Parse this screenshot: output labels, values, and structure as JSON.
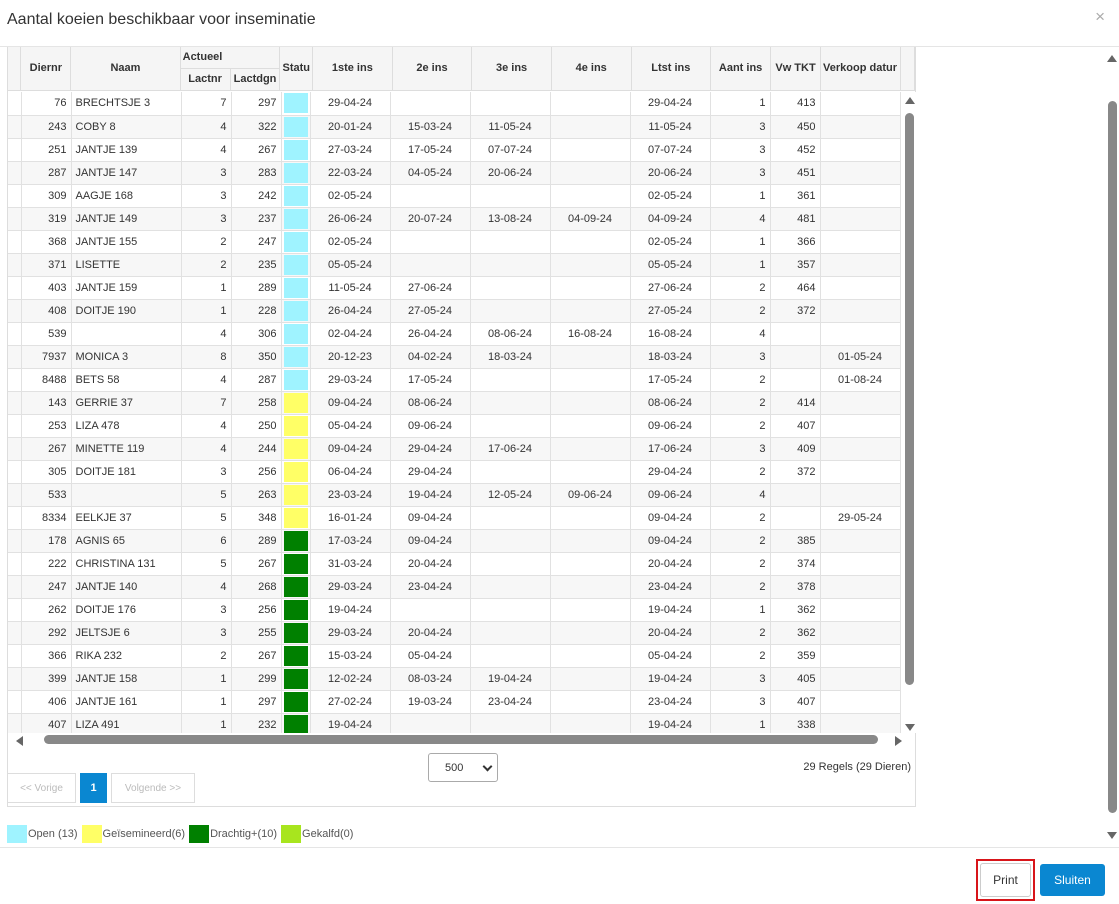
{
  "modal": {
    "title": "Aantal koeien beschikbaar voor inseminatie",
    "close_glyph": "×"
  },
  "table": {
    "group_header": "Actueel",
    "columns": {
      "diernr": "Diernr",
      "naam": "Naam",
      "lactnr": "Lactnr",
      "lactdgn": "Lactdgn",
      "status": "Statu",
      "ins1": "1ste ins",
      "ins2": "2e ins",
      "ins3": "3e ins",
      "ins4": "4e ins",
      "ltst": "Ltst ins",
      "aant": "Aant ins",
      "vwtkt": "Vw TKT",
      "verkoop": "Verkoop datur"
    },
    "rows": [
      [
        "76",
        "BRECHTSJE 3",
        "7",
        "297",
        "open",
        "29-04-24",
        "",
        "",
        "",
        "29-04-24",
        "1",
        "413",
        ""
      ],
      [
        "243",
        "COBY 8",
        "4",
        "322",
        "open",
        "20-01-24",
        "15-03-24",
        "11-05-24",
        "",
        "11-05-24",
        "3",
        "450",
        ""
      ],
      [
        "251",
        "JANTJE 139",
        "4",
        "267",
        "open",
        "27-03-24",
        "17-05-24",
        "07-07-24",
        "",
        "07-07-24",
        "3",
        "452",
        ""
      ],
      [
        "287",
        "JANTJE 147",
        "3",
        "283",
        "open",
        "22-03-24",
        "04-05-24",
        "20-06-24",
        "",
        "20-06-24",
        "3",
        "451",
        ""
      ],
      [
        "309",
        "AAGJE 168",
        "3",
        "242",
        "open",
        "02-05-24",
        "",
        "",
        "",
        "02-05-24",
        "1",
        "361",
        ""
      ],
      [
        "319",
        "JANTJE 149",
        "3",
        "237",
        "open",
        "26-06-24",
        "20-07-24",
        "13-08-24",
        "04-09-24",
        "04-09-24",
        "4",
        "481",
        ""
      ],
      [
        "368",
        "JANTJE 155",
        "2",
        "247",
        "open",
        "02-05-24",
        "",
        "",
        "",
        "02-05-24",
        "1",
        "366",
        ""
      ],
      [
        "371",
        "LISETTE",
        "2",
        "235",
        "open",
        "05-05-24",
        "",
        "",
        "",
        "05-05-24",
        "1",
        "357",
        ""
      ],
      [
        "403",
        "JANTJE 159",
        "1",
        "289",
        "open",
        "11-05-24",
        "27-06-24",
        "",
        "",
        "27-06-24",
        "2",
        "464",
        ""
      ],
      [
        "408",
        "DOITJE 190",
        "1",
        "228",
        "open",
        "26-04-24",
        "27-05-24",
        "",
        "",
        "27-05-24",
        "2",
        "372",
        ""
      ],
      [
        "539",
        "",
        "4",
        "306",
        "open",
        "02-04-24",
        "26-04-24",
        "08-06-24",
        "16-08-24",
        "16-08-24",
        "4",
        "",
        ""
      ],
      [
        "7937",
        "MONICA 3",
        "8",
        "350",
        "open",
        "20-12-23",
        "04-02-24",
        "18-03-24",
        "",
        "18-03-24",
        "3",
        "",
        "01-05-24"
      ],
      [
        "8488",
        "BETS 58",
        "4",
        "287",
        "open",
        "29-03-24",
        "17-05-24",
        "",
        "",
        "17-05-24",
        "2",
        "",
        "01-08-24"
      ],
      [
        "143",
        "GERRIE 37",
        "7",
        "258",
        "ins",
        "09-04-24",
        "08-06-24",
        "",
        "",
        "08-06-24",
        "2",
        "414",
        ""
      ],
      [
        "253",
        "LIZA 478",
        "4",
        "250",
        "ins",
        "05-04-24",
        "09-06-24",
        "",
        "",
        "09-06-24",
        "2",
        "407",
        ""
      ],
      [
        "267",
        "MINETTE 119",
        "4",
        "244",
        "ins",
        "09-04-24",
        "29-04-24",
        "17-06-24",
        "",
        "17-06-24",
        "3",
        "409",
        ""
      ],
      [
        "305",
        "DOITJE 181",
        "3",
        "256",
        "ins",
        "06-04-24",
        "29-04-24",
        "",
        "",
        "29-04-24",
        "2",
        "372",
        ""
      ],
      [
        "533",
        "",
        "5",
        "263",
        "ins",
        "23-03-24",
        "19-04-24",
        "12-05-24",
        "09-06-24",
        "09-06-24",
        "4",
        "",
        ""
      ],
      [
        "8334",
        "EELKJE 37",
        "5",
        "348",
        "ins",
        "16-01-24",
        "09-04-24",
        "",
        "",
        "09-04-24",
        "2",
        "",
        "29-05-24"
      ],
      [
        "178",
        "AGNIS 65",
        "6",
        "289",
        "preg",
        "17-03-24",
        "09-04-24",
        "",
        "",
        "09-04-24",
        "2",
        "385",
        ""
      ],
      [
        "222",
        "CHRISTINA 131",
        "5",
        "267",
        "preg",
        "31-03-24",
        "20-04-24",
        "",
        "",
        "20-04-24",
        "2",
        "374",
        ""
      ],
      [
        "247",
        "JANTJE 140",
        "4",
        "268",
        "preg",
        "29-03-24",
        "23-04-24",
        "",
        "",
        "23-04-24",
        "2",
        "378",
        ""
      ],
      [
        "262",
        "DOITJE 176",
        "3",
        "256",
        "preg",
        "19-04-24",
        "",
        "",
        "",
        "19-04-24",
        "1",
        "362",
        ""
      ],
      [
        "292",
        "JELTSJE 6",
        "3",
        "255",
        "preg",
        "29-03-24",
        "20-04-24",
        "",
        "",
        "20-04-24",
        "2",
        "362",
        ""
      ],
      [
        "366",
        "RIKA 232",
        "2",
        "267",
        "preg",
        "15-03-24",
        "05-04-24",
        "",
        "",
        "05-04-24",
        "2",
        "359",
        ""
      ],
      [
        "399",
        "JANTJE 158",
        "1",
        "299",
        "preg",
        "12-02-24",
        "08-03-24",
        "19-04-24",
        "",
        "19-04-24",
        "3",
        "405",
        ""
      ],
      [
        "406",
        "JANTJE 161",
        "1",
        "297",
        "preg",
        "27-02-24",
        "19-03-24",
        "23-04-24",
        "",
        "23-04-24",
        "3",
        "407",
        ""
      ],
      [
        "407",
        "LIZA 491",
        "1",
        "232",
        "preg",
        "19-04-24",
        "",
        "",
        "",
        "19-04-24",
        "1",
        "338",
        ""
      ]
    ]
  },
  "status_colors": {
    "open": "#9ff3ff",
    "ins": "#ffff66",
    "preg": "#008000",
    "calved": "#a8e51e"
  },
  "pager": {
    "prev": "<< Vorige",
    "current": "1",
    "next": "Volgende >>",
    "page_size": "500",
    "count": "29 Regels (29 Dieren)"
  },
  "legend": [
    {
      "key": "open",
      "label": "Open (13)"
    },
    {
      "key": "ins",
      "label": "Geïsemineerd(6)"
    },
    {
      "key": "preg",
      "label": "Drachtig+(10)"
    },
    {
      "key": "calved",
      "label": "Gekalfd(0)"
    }
  ],
  "footer": {
    "print": "Print",
    "close": "Sluiten"
  }
}
